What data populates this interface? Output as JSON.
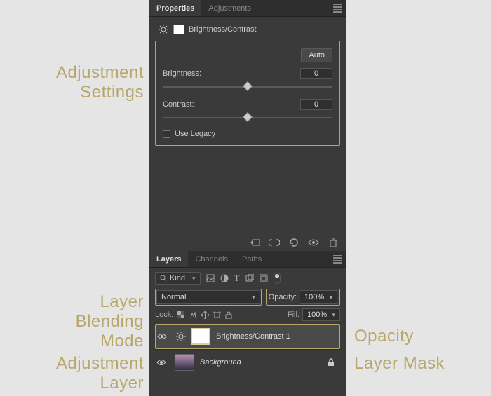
{
  "annotations": {
    "adjustment_settings": "Adjustment\nSettings",
    "blend_mode": "Layer\nBlending\nMode",
    "adjustment_layer": "Adjustment\nLayer",
    "opacity": "Opacity",
    "layer_mask": "Layer Mask"
  },
  "properties": {
    "tabs": {
      "properties": "Properties",
      "adjustments": "Adjustments"
    },
    "adjustment_name": "Brightness/Contrast",
    "auto_label": "Auto",
    "brightness_label": "Brightness:",
    "brightness_value": "0",
    "contrast_label": "Contrast:",
    "contrast_value": "0",
    "use_legacy_label": "Use Legacy"
  },
  "layers": {
    "tabs": {
      "layers": "Layers",
      "channels": "Channels",
      "paths": "Paths"
    },
    "kind_label": "Kind",
    "blend_mode": "Normal",
    "opacity_label": "Opacity:",
    "opacity_value": "100%",
    "lock_label": "Lock:",
    "fill_label": "Fill:",
    "fill_value": "100%",
    "rows": [
      {
        "name": "Brightness/Contrast 1"
      },
      {
        "name": "Background"
      }
    ]
  }
}
